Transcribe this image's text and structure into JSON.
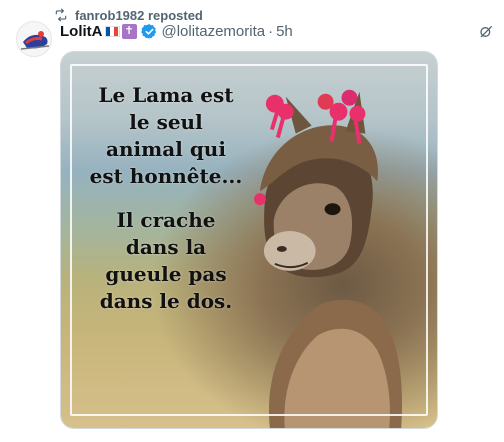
{
  "repost": {
    "text": "fanrob1982 reposted",
    "icon": "repost-icon"
  },
  "post": {
    "display_name": "LolitA",
    "flag_colors": [
      "#0055a4",
      "#ffffff",
      "#ef4135"
    ],
    "badge_glyph": "✝",
    "verified_color": "#1d9bf0",
    "handle": "@lolitazemorita",
    "separator": "·",
    "time": "5h",
    "top_action_icon": "grok-icon"
  },
  "media": {
    "caption_lines_1": [
      "Le Lama est",
      "le seul",
      "animal qui",
      "est honnête..."
    ],
    "caption_lines_2": [
      "Il crache",
      "dans la",
      "gueule pas",
      "dans le dos."
    ]
  }
}
